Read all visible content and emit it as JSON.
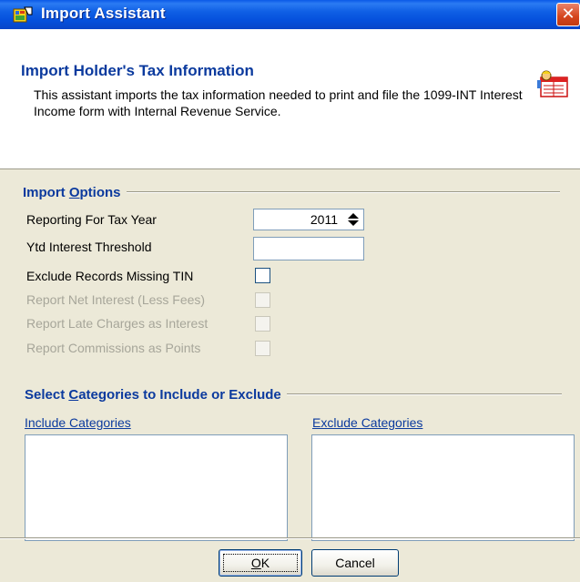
{
  "window": {
    "title": "Import Assistant",
    "close_glyph": "✕"
  },
  "header": {
    "title": "Import Holder's Tax Information",
    "description": "This assistant imports the tax information needed to print and file the 1099-INT Interest Income form with Internal Revenue Service."
  },
  "import_options": {
    "heading_pre": "Import ",
    "heading_accel": "O",
    "heading_post": "ptions",
    "tax_year_label": "Reporting For Tax Year",
    "tax_year_value": "2011",
    "threshold_label": "Ytd Interest Threshold",
    "threshold_value": "",
    "exclude_missing_tin_label": "Exclude Records Missing TIN",
    "report_net_interest_label": "Report Net Interest (Less Fees)",
    "report_late_charges_label": "Report Late Charges as Interest",
    "report_commissions_label": "Report Commissions as Points"
  },
  "categories": {
    "heading_pre": "Select ",
    "heading_accel": "C",
    "heading_post": "ategories to Include or Exclude",
    "include_label": "Include Categories",
    "exclude_label": "Exclude Categories"
  },
  "buttons": {
    "ok_accel": "O",
    "ok_rest": "K",
    "cancel": "Cancel"
  },
  "icons": {
    "title_icon": "import-wizard-icon",
    "header_icon": "tax-form-icon"
  }
}
